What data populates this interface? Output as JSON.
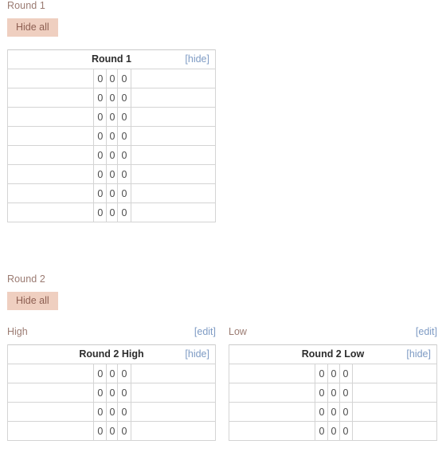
{
  "page": {
    "background": "#ffffff",
    "accent_button_bg": "#efcfc0",
    "accent_button_text": "#8d5f52",
    "heading_color": "#9b7b72",
    "link_color": "#7e9bc4",
    "border_color": "#d4d4d4"
  },
  "sections": [
    {
      "id": "round-1",
      "title": "Round 1",
      "hide_all_label": "Hide all",
      "tables": [
        {
          "id": "round-1-table",
          "header_title": "Round 1",
          "hide_label": "[hide]",
          "columns": [
            "",
            "",
            "",
            "",
            ""
          ],
          "rows": [
            [
              "",
              "0",
              "0",
              "0",
              ""
            ],
            [
              "",
              "0",
              "0",
              "0",
              ""
            ],
            [
              "",
              "0",
              "0",
              "0",
              ""
            ],
            [
              "",
              "0",
              "0",
              "0",
              ""
            ],
            [
              "",
              "0",
              "0",
              "0",
              ""
            ],
            [
              "",
              "0",
              "0",
              "0",
              ""
            ],
            [
              "",
              "0",
              "0",
              "0",
              ""
            ],
            [
              "",
              "0",
              "0",
              "0",
              ""
            ]
          ]
        }
      ]
    },
    {
      "id": "round-2",
      "title": "Round 2",
      "hide_all_label": "Hide all",
      "tables": [
        {
          "id": "round-2-high-table",
          "sublabel": "High",
          "edit_label": "[edit]",
          "header_title": "Round 2 High",
          "hide_label": "[hide]",
          "rows": [
            [
              "",
              "0",
              "0",
              "0",
              ""
            ],
            [
              "",
              "0",
              "0",
              "0",
              ""
            ],
            [
              "",
              "0",
              "0",
              "0",
              ""
            ],
            [
              "",
              "0",
              "0",
              "0",
              ""
            ]
          ]
        },
        {
          "id": "round-2-low-table",
          "sublabel": "Low",
          "edit_label": "[edit]",
          "header_title": "Round 2 Low",
          "hide_label": "[hide]",
          "rows": [
            [
              "",
              "0",
              "0",
              "0",
              ""
            ],
            [
              "",
              "0",
              "0",
              "0",
              ""
            ],
            [
              "",
              "0",
              "0",
              "0",
              ""
            ],
            [
              "",
              "0",
              "0",
              "0",
              ""
            ]
          ]
        }
      ]
    }
  ]
}
